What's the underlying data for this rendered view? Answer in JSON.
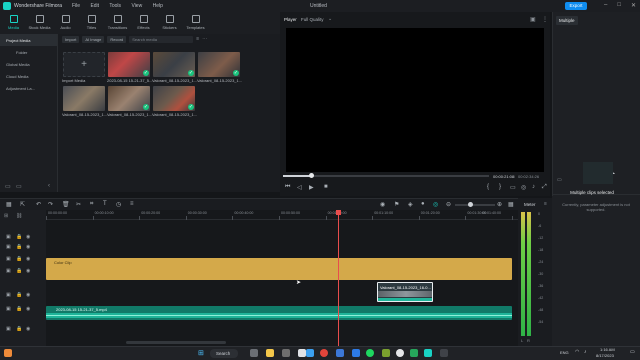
{
  "window": {
    "app_name": "Wondershare Filmora",
    "doc_title": "Untitled",
    "export_label": "Export",
    "menu": [
      "File",
      "Edit",
      "Tools",
      "View",
      "Help"
    ]
  },
  "toolbar": {
    "tools": [
      {
        "label": "Media",
        "icon": "media-icon",
        "active": true
      },
      {
        "label": "Stock Media",
        "icon": "stock-media-icon",
        "active": false
      },
      {
        "label": "Audio",
        "icon": "audio-icon",
        "active": false
      },
      {
        "label": "Titles",
        "icon": "titles-icon",
        "active": false
      },
      {
        "label": "Transitions",
        "icon": "transitions-icon",
        "active": false
      },
      {
        "label": "Effects",
        "icon": "effects-icon",
        "active": false
      },
      {
        "label": "Stickers",
        "icon": "stickers-icon",
        "active": false
      },
      {
        "label": "Templates",
        "icon": "templates-icon",
        "active": false
      }
    ]
  },
  "sidebar": {
    "items": [
      {
        "label": "Project Media",
        "selected": true,
        "indent": false
      },
      {
        "label": "Folder",
        "selected": false,
        "indent": true
      },
      {
        "label": "Global Media",
        "selected": false,
        "indent": false
      },
      {
        "label": "Cloud Media",
        "selected": false,
        "indent": false
      },
      {
        "label": "Adjustment La...",
        "selected": false,
        "indent": false
      }
    ]
  },
  "media": {
    "import_label": "Import",
    "ai_image_label": "AI Image",
    "record_label": "Record",
    "search_placeholder": "Search media",
    "import_media_label": "Import Media",
    "items": [
      "2023-08-15 15-21-37_5...",
      "Valorant_08-15-2023_1...",
      "Valorant_08-15-2023_1...",
      "Valorant_08-15-2023_1...",
      "Valorant_08-15-2023_1...",
      "Valorant_08-15-2023_1..."
    ]
  },
  "player": {
    "tab_player": "Player",
    "quality": "Full Quality",
    "current_time": "00:00:21:08",
    "total_time": "00:02:34:26",
    "progress": 0.138
  },
  "right_panel": {
    "tab": "Multiple",
    "message_title": "Multiple clips selected",
    "message_body": "Currently, parameter adjustment is not supported."
  },
  "timeline": {
    "ruler": [
      "00:00:00:00",
      "00:00:10:00",
      "00:00:20:00",
      "00:00:30:00",
      "00:00:40:00",
      "00:00:50:00",
      "00:01:00:00",
      "00:01:10:00",
      "00:01:20:00",
      "00:01:30:00",
      "00:01:40:00"
    ],
    "clip_color_label": "Color Clip",
    "video_clip_label": "Valorant_08-15-2023_16-0...",
    "audio_clip_label": "2023-08-15 15-21-37_5.mp4",
    "meter_label": "Meter",
    "meter_scale": [
      "0",
      "-6",
      "-12",
      "-18",
      "-24",
      "-30",
      "-36",
      "-42",
      "-48",
      "-54"
    ],
    "meter_lr": [
      "L",
      "R"
    ],
    "playhead_fraction": 0.627
  },
  "taskbar": {
    "search_label": "Search",
    "lang": "ENG",
    "time": "1:16 AM",
    "date": "8/17/2023"
  },
  "colors": {
    "accent": "#19d3c5",
    "export_blue": "#0f8df0",
    "color_clip": "#d4a94a",
    "audio_wave": "#1fb59a",
    "playhead": "#e84d4d"
  }
}
